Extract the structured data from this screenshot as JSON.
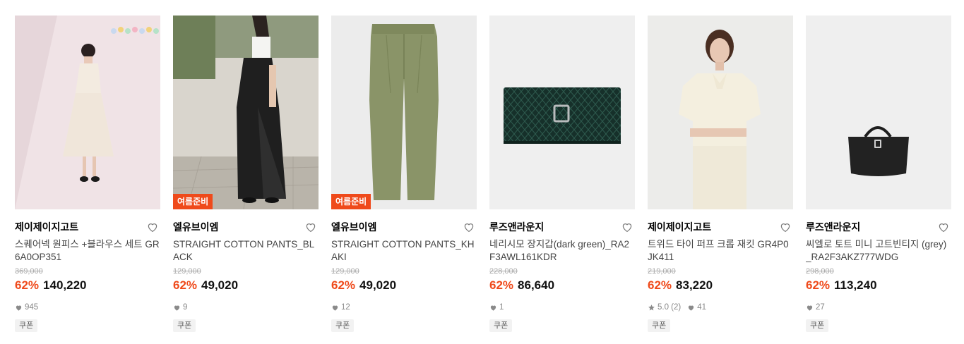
{
  "products": [
    {
      "brand": "제이제이지고트",
      "name": "스퀘어넥 원피스 +블라우스 세트 GR6A0OP351",
      "original_price": "369,000",
      "discount": "62%",
      "price": "140,220",
      "likes": "945",
      "coupon": "쿠폰",
      "image": "photo-woman-white-dress"
    },
    {
      "brand": "엘유브이엠",
      "name": "STRAIGHT COTTON PANTS_BLACK",
      "original_price": "129,000",
      "discount": "62%",
      "price": "49,020",
      "likes": "9",
      "coupon": "쿠폰",
      "tag": "여름준비",
      "image": "photo-woman-black-pants"
    },
    {
      "brand": "엘유브이엠",
      "name": "STRAIGHT COTTON PANTS_KHAKI",
      "original_price": "129,000",
      "discount": "62%",
      "price": "49,020",
      "likes": "12",
      "coupon": "쿠폰",
      "tag": "여름준비",
      "image": "photo-khaki-pants"
    },
    {
      "brand": "루즈앤라운지",
      "name": "네리시모 장지갑(dark green)_RA2F3AWL161KDR",
      "original_price": "228,000",
      "discount": "62%",
      "price": "86,640",
      "likes": "1",
      "coupon": "쿠폰",
      "image": "photo-green-wallet"
    },
    {
      "brand": "제이제이지고트",
      "name": "트위드 타이 퍼프 크롭 재킷 GR4P0JK411",
      "original_price": "219,000",
      "discount": "62%",
      "price": "83,220",
      "rating": "5.0 (2)",
      "likes": "41",
      "coupon": "쿠폰",
      "image": "photo-cream-jacket"
    },
    {
      "brand": "루즈앤라운지",
      "name": "씨엘로 토트 미니 고트빈티지 (grey)_RA2F3AKZ777WDG",
      "original_price": "298,000",
      "discount": "62%",
      "price": "113,240",
      "likes": "27",
      "coupon": "쿠폰",
      "image": "photo-black-tote"
    }
  ],
  "colors": {
    "accent": "#ef4a1b",
    "muted": "#888888",
    "strike": "#aaaaaa"
  }
}
